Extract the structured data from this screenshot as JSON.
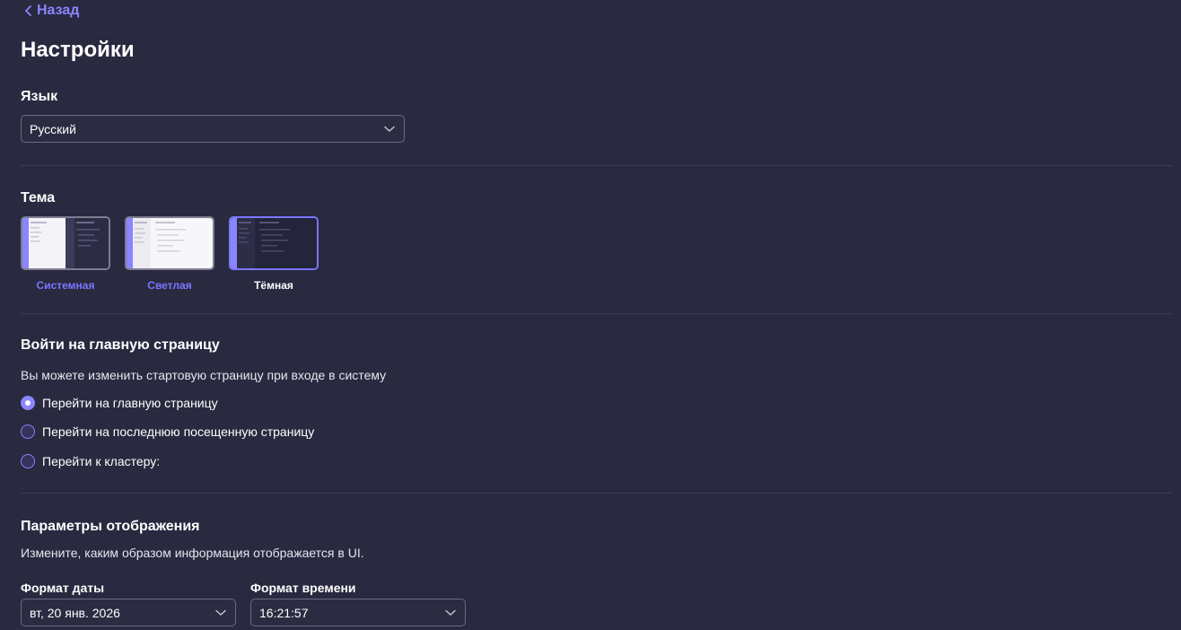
{
  "nav": {
    "back_label": "Назад"
  },
  "page": {
    "title": "Настройки"
  },
  "language": {
    "title": "Язык",
    "selected": "Русский"
  },
  "theme": {
    "title": "Тема",
    "options": [
      {
        "label": "Системная"
      },
      {
        "label": "Светлая"
      },
      {
        "label": "Тёмная"
      }
    ],
    "selected": "Тёмная"
  },
  "start_page": {
    "title": "Войти на главную страницу",
    "description": "Вы можете изменить стартовую страницу при входе в систему",
    "options": [
      {
        "label": "Перейти на главную страницу",
        "checked": true
      },
      {
        "label": "Перейти на последнюю посещенную страницу",
        "checked": false
      },
      {
        "label": "Перейти к кластеру:",
        "checked": false
      }
    ]
  },
  "display": {
    "title": "Параметры отображения",
    "description": "Измените, каким образом информация отображается в UI.",
    "date_format": {
      "label": "Формат даты",
      "value": "вт, 20 янв. 2026"
    },
    "time_format": {
      "label": "Формат времени",
      "value": "16:21:57"
    }
  },
  "colors": {
    "background": "#292940",
    "accent": "#8a86ff",
    "divider": "#3b3b55"
  },
  "icons": {
    "back": "chevron-left-icon",
    "dropdown": "chevron-down-icon"
  }
}
